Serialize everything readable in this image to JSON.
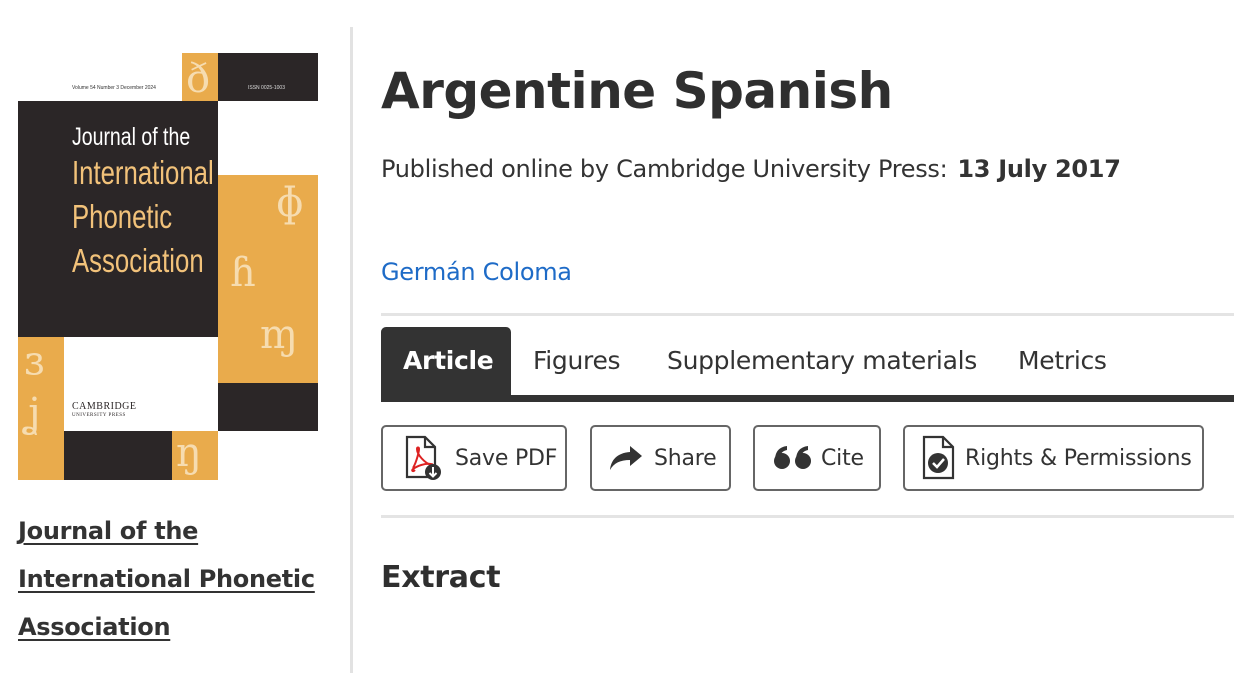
{
  "cover": {
    "issue_info": "Volume 54 Number 3 December 2024",
    "issn": "ISSN 0025-1003",
    "title_lines": [
      "Journal of the",
      "International",
      "Phonetic",
      "Association"
    ],
    "publisher_line1": "CAMBRIDGE",
    "publisher_line2": "UNIVERSITY PRESS",
    "glyphs": [
      "ð",
      "ɸ",
      "ɦ",
      "ɱ",
      "ɜ",
      "ʝ",
      "ŋ"
    ],
    "colors": {
      "dark": "#2b2627",
      "gold": "#e9ab4c",
      "title_white": "#ffffff",
      "title_gold": "#f2c27a"
    }
  },
  "journal_link": {
    "lines": [
      "Journal of the",
      "International Phonetic",
      "Association"
    ]
  },
  "article": {
    "title": "Argentine Spanish",
    "published_prefix": "Published online by Cambridge University Press:",
    "published_date": "13 July 2017",
    "author": "Germán Coloma"
  },
  "tabs": [
    {
      "label": "Article",
      "active": true
    },
    {
      "label": "Figures",
      "active": false
    },
    {
      "label": "Supplementary materials",
      "active": false
    },
    {
      "label": "Metrics",
      "active": false
    }
  ],
  "actions": [
    {
      "label": "Save PDF",
      "icon": "pdf-download-icon"
    },
    {
      "label": "Share",
      "icon": "share-arrow-icon"
    },
    {
      "label": "Cite",
      "icon": "quote-icon"
    },
    {
      "label": "Rights & Permissions",
      "icon": "document-check-icon"
    }
  ],
  "section_heading": "Extract",
  "colors": {
    "link": "#1e6bc7",
    "text": "#333333",
    "tab_active_bg": "#333333",
    "divider": "#e4e4e4"
  }
}
